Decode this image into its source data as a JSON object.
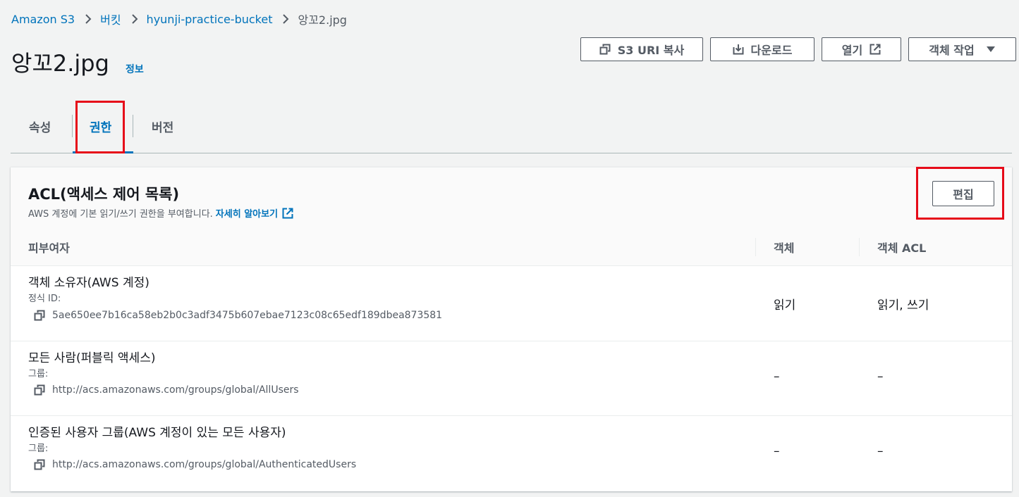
{
  "breadcrumb": {
    "items": [
      "Amazon S3",
      "버킷",
      "hyunji-practice-bucket"
    ],
    "current": "앙꼬2.jpg"
  },
  "page": {
    "title": "앙꼬2.jpg",
    "info_link": "정보"
  },
  "actions": {
    "copy_uri": "S3 URI 복사",
    "download": "다운로드",
    "open": "열기",
    "object_actions": "객체 작업"
  },
  "tabs": [
    "속성",
    "권한",
    "버전"
  ],
  "active_tab": "권한",
  "acl": {
    "title": "ACL(액세스 제어 목록)",
    "description": "AWS 계정에 기본 읽기/쓰기 권한을 부여합니다.",
    "learn_more": "자세히 알아보기",
    "edit_label": "편집",
    "columns": [
      "피부여자",
      "객체",
      "객체 ACL"
    ],
    "rows": [
      {
        "grantee": "객체 소유자(AWS 계정)",
        "id_label": "정식 ID:",
        "id_value": "5ae650ee7b16ca58eb2b0c3adf3475b607ebae7123c08c65edf189dbea873581",
        "object": "읽기",
        "object_acl": "읽기, 쓰기"
      },
      {
        "grantee": "모든 사람(퍼블릭 액세스)",
        "id_label": "그룹:",
        "id_value": "http://acs.amazonaws.com/groups/global/AllUsers",
        "object": "–",
        "object_acl": "–"
      },
      {
        "grantee": "인증된 사용자 그룹(AWS 계정이 있는 모든 사용자)",
        "id_label": "그룹:",
        "id_value": "http://acs.amazonaws.com/groups/global/AuthenticatedUsers",
        "object": "–",
        "object_acl": "–"
      }
    ]
  },
  "colors": {
    "link": "#0073bb",
    "text": "#16191f",
    "muted": "#545b64",
    "highlight": "#e60b19",
    "background": "#f2f3f3"
  },
  "icons": [
    "chevron-right-icon",
    "copy-icon",
    "download-icon",
    "external-link-icon",
    "caret-down-icon"
  ]
}
